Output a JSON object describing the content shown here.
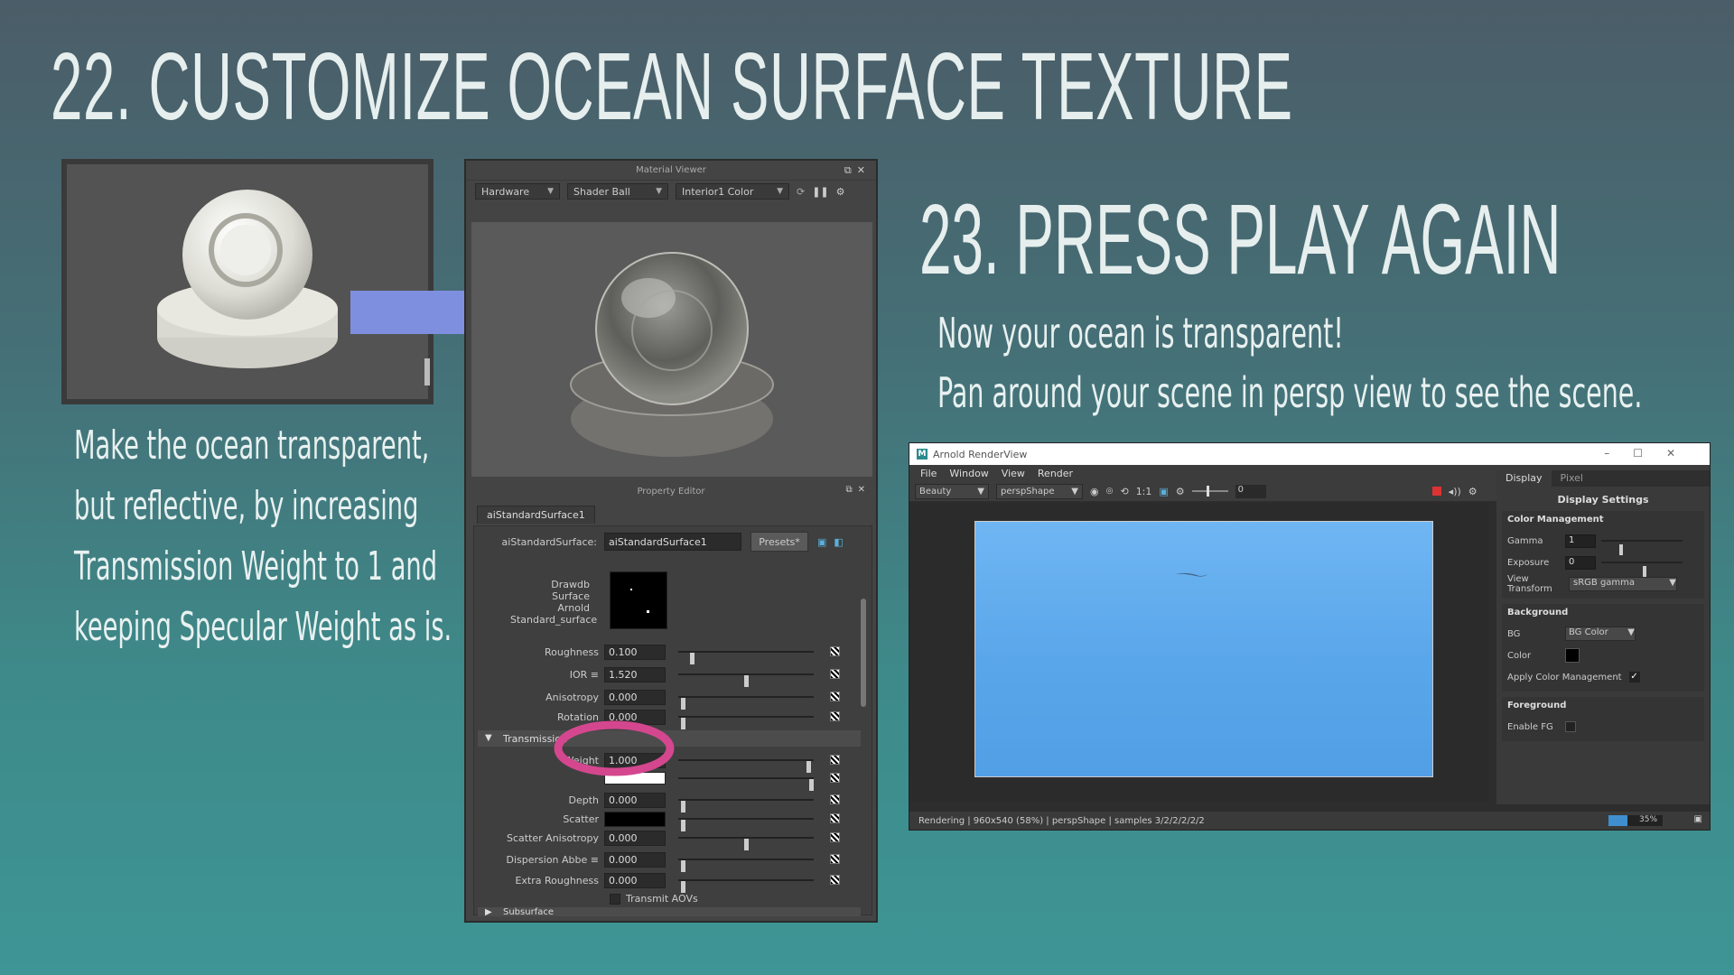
{
  "slide": {
    "title_left": "22. CUSTOMIZE OCEAN SURFACE TEXTURE",
    "title_right": "23. PRESS PLAY AGAIN",
    "left_text": [
      "Make the ocean transparent,",
      "but reflective, by increasing",
      "Transmission Weight to 1 and",
      "keeping Specular Weight as is."
    ],
    "right_text": [
      "Now your ocean is transparent!",
      "Pan around your scene in persp view to see the scene."
    ]
  },
  "material_viewer": {
    "title": "Material Viewer",
    "renderer": "Hardware",
    "geometry": "Shader Ball",
    "environment": "Interior1 Color"
  },
  "property_editor": {
    "title": "Property Editor",
    "tab": "aiStandardSurface1",
    "node_label": "aiStandardSurface:",
    "node_value": "aiStandardSurface1",
    "presets": "Presets*",
    "swatch_labels": [
      "Drawdb",
      "Surface",
      "Arnold",
      "Standard_surface"
    ],
    "rows": [
      {
        "label": "Roughness",
        "value": "0.100",
        "pos": 0.09
      },
      {
        "label": "IOR ≡",
        "value": "1.520",
        "pos": 0.5
      },
      {
        "label": "Anisotropy",
        "value": "0.000",
        "pos": 0.02
      },
      {
        "label": "Rotation",
        "value": "0.000",
        "pos": 0.02
      }
    ],
    "transmission_section": "Transmission",
    "transmission_rows": [
      {
        "label": "Weight",
        "value": "1.000",
        "pos": 0.98
      },
      {
        "label": "Depth",
        "value": "0.000",
        "pos": 0.02
      },
      {
        "label": "Scatter",
        "value": "",
        "pos": 0.02
      },
      {
        "label": "Scatter Anisotropy",
        "value": "0.000",
        "pos": 0.5
      },
      {
        "label": "Dispersion Abbe ≡",
        "value": "0.000",
        "pos": 0.02
      },
      {
        "label": "Extra Roughness",
        "value": "0.000",
        "pos": 0.02
      }
    ],
    "transmit_aovs": "Transmit AOVs",
    "next_section": "Subsurface"
  },
  "arnold": {
    "title": "Arnold RenderView",
    "menu": [
      "File",
      "Window",
      "View",
      "Render"
    ],
    "aov": "Beauty",
    "camera": "perspShape",
    "ratio": "1:1",
    "exposure_value": "0",
    "status": "Rendering | 960x540 (58%) | perspShape  | samples 3/2/2/2/2/2",
    "progress": "35%",
    "tabs": [
      "Display",
      "Pixel"
    ],
    "settings_title": "Display Settings",
    "color_mgmt": "Color Management",
    "gamma_label": "Gamma",
    "gamma_value": "1",
    "exposure_label": "Exposure",
    "exposure_setting": "0",
    "view_transform_label": "View Transform",
    "view_transform": "sRGB gamma",
    "background": "Background",
    "bg_label": "BG",
    "bg_value": "BG Color",
    "color_label": "Color",
    "apply_cm": "Apply Color Management",
    "foreground": "Foreground",
    "enable_fg": "Enable FG"
  },
  "colors": {
    "arrow": "#7f8fe0",
    "highlight_ring": "#d4478f",
    "render_sky": "#5aa6ea"
  }
}
